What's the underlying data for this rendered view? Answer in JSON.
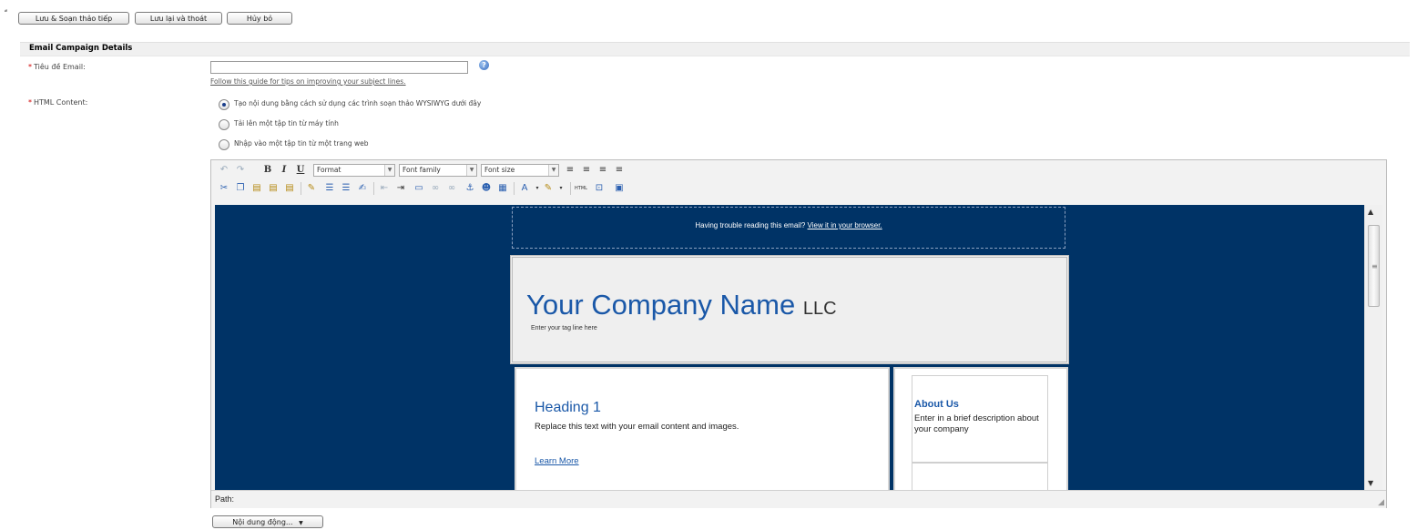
{
  "top_bar": {
    "buttons": [
      {
        "label": "Lưu & Soạn thảo tiếp"
      },
      {
        "label": "Lưu lại và thoát"
      },
      {
        "label": "Hủy bỏ"
      }
    ]
  },
  "section": {
    "title": "Email Campaign Details"
  },
  "form": {
    "subject_label": "Tiêu đề Email:",
    "subject_value": "",
    "guide_link": "Follow this guide for tips on improving your subject lines.",
    "help_icon": "?",
    "html_content_label": "HTML Content:",
    "required_marker": "*",
    "options": [
      {
        "label": "Tạo nội dung bằng cách sử dụng các trình soạn thảo WYSIWYG dưới đây",
        "checked": true
      },
      {
        "label": "Tải lên một tập tin từ máy tính",
        "checked": false
      },
      {
        "label": "Nhập vào một tập tin từ một trang web",
        "checked": false
      }
    ]
  },
  "toolbar": {
    "format_select": "Format",
    "font_family_select": "Font family",
    "font_size_select": "Font size",
    "bold": "B",
    "italic": "I",
    "underline": "U"
  },
  "email_preview": {
    "preheader_text": "Having trouble reading this email?",
    "preheader_link": "View it in your browser.",
    "company_name": "Your Company Name",
    "company_suffix": "LLC",
    "tagline": "Enter your tag line here",
    "heading": "Heading 1",
    "body_text": "Replace this text with your email content and images.",
    "learn_more": "Learn More",
    "about_title": "About Us",
    "about_text": "Enter in a brief description about your company",
    "background_color": "#003366",
    "accent_color": "#1a58a8"
  },
  "path_bar": {
    "label": "Path:"
  },
  "bottom": {
    "dynamic_content_button": "Nội dung động..."
  }
}
